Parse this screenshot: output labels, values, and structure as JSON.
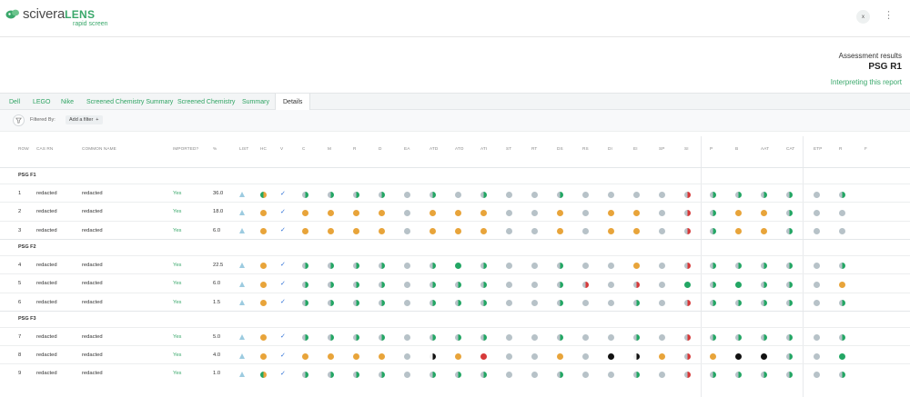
{
  "app": {
    "brand_main": "sciveraLENS",
    "brand_prefix": "scivera",
    "brand_suffix": "LENS",
    "brand_sub": "rapid screen",
    "user_initial": "x",
    "menu_icon": "kebab-icon"
  },
  "report": {
    "label": "Assessment results",
    "title": "PSG R1",
    "help_link": "Interpreting this report"
  },
  "tabs": [
    "Dell",
    "LEGO",
    "Nike",
    "Screened Chemistry Summary",
    "Screened Chemistry",
    "Summary",
    "Details"
  ],
  "active_tab": "Details",
  "filter": {
    "label": "Filtered By:",
    "add_label": "Add a filter",
    "add_icon": "+"
  },
  "table": {
    "columns": [
      "ROW",
      "CAS RN",
      "COMMON NAME",
      "IMPORTED?",
      "%",
      "LIST",
      "HC",
      "V",
      "C",
      "M",
      "R",
      "D",
      "EA",
      "atd",
      "ato",
      "ati",
      "st",
      "rt",
      "ds",
      "rs",
      "di",
      "ei",
      "sp",
      "si",
      "P",
      "B",
      "AAT",
      "CAT",
      "etp",
      "r",
      "f"
    ],
    "groups": [
      {
        "name": "PSG F1",
        "rows": [
          {
            "row": "1",
            "cas": "redacted",
            "name": "redacted",
            "imported": "Yes",
            "pct": "36.0",
            "ind": [
              "tri",
              "og",
              "chk",
              "gg",
              "gg",
              "gg",
              "gg",
              "gl",
              "gg",
              "gl",
              "gg",
              "gl",
              "gl",
              "gg",
              "gl",
              "go",
              "gl",
              "gl",
              "rg",
              "gg",
              "gg",
              "gg",
              "gg",
              "gl",
              "gg"
            ]
          },
          {
            "row": "2",
            "cas": "redacted",
            "name": "redacted",
            "imported": "Yes",
            "pct": "18.0",
            "ind": [
              "tri",
              "o",
              "chk",
              "o",
              "o",
              "o",
              "o",
              "gl",
              "o",
              "o",
              "o",
              "gl",
              "gl",
              "o",
              "gl",
              "o",
              "o",
              "gl",
              "rg",
              "gg",
              "o",
              "o",
              "gg",
              "gl",
              "gl"
            ]
          },
          {
            "row": "3",
            "cas": "redacted",
            "name": "redacted",
            "imported": "Yes",
            "pct": "6.0",
            "ind": [
              "tri",
              "o",
              "chk",
              "o",
              "o",
              "o",
              "o",
              "gl",
              "o",
              "o",
              "o",
              "gl",
              "gl",
              "o",
              "gl",
              "o",
              "o",
              "gl",
              "rg",
              "gg",
              "o",
              "o",
              "gg",
              "gl",
              "gl"
            ]
          }
        ]
      },
      {
        "name": "PSG F2",
        "rows": [
          {
            "row": "4",
            "cas": "redacted",
            "name": "redacted",
            "imported": "Yes",
            "pct": "22.5",
            "ind": [
              "tri",
              "o",
              "chk",
              "gg",
              "gg",
              "gg",
              "gg",
              "gl",
              "gg",
              "G",
              "gg",
              "gl",
              "gl",
              "gg",
              "gl",
              "gl",
              "o",
              "gl",
              "rg",
              "gg",
              "gg",
              "gg",
              "gg",
              "gl",
              "gg"
            ]
          },
          {
            "row": "5",
            "cas": "redacted",
            "name": "redacted",
            "imported": "Yes",
            "pct": "6.0",
            "ind": [
              "tri",
              "o",
              "chk",
              "gg",
              "gg",
              "gg",
              "gg",
              "gl",
              "gg",
              "gg",
              "gg",
              "gl",
              "gl",
              "gg",
              "rg",
              "gl",
              "rg",
              "gl",
              "G",
              "gg",
              "G",
              "gg",
              "gg",
              "gl",
              "o"
            ]
          },
          {
            "row": "6",
            "cas": "redacted",
            "name": "redacted",
            "imported": "Yes",
            "pct": "1.5",
            "ind": [
              "tri",
              "o",
              "chk",
              "gg",
              "gg",
              "gg",
              "gg",
              "gl",
              "gg",
              "gg",
              "gg",
              "gl",
              "gl",
              "gg",
              "gl",
              "gl",
              "gg",
              "gl",
              "rg",
              "gg",
              "gg",
              "gg",
              "gg",
              "gl",
              "gg"
            ]
          }
        ]
      },
      {
        "name": "PSG F3",
        "rows": [
          {
            "row": "7",
            "cas": "redacted",
            "name": "redacted",
            "imported": "Yes",
            "pct": "5.0",
            "ind": [
              "tri",
              "o",
              "chk",
              "gg",
              "gg",
              "gg",
              "gg",
              "gl",
              "gg",
              "gg",
              "gg",
              "gl",
              "gl",
              "gg",
              "gl",
              "gl",
              "gg",
              "gl",
              "rg",
              "gg",
              "gg",
              "gg",
              "gg",
              "gl",
              "gg"
            ]
          },
          {
            "row": "8",
            "cas": "redacted",
            "name": "redacted",
            "imported": "Yes",
            "pct": "4.0",
            "ind": [
              "tri",
              "o",
              "chk",
              "o",
              "o",
              "o",
              "o",
              "gl",
              "kh",
              "o",
              "R",
              "gl",
              "gl",
              "o",
              "gl",
              "K",
              "kh",
              "o",
              "rg",
              "o",
              "K",
              "K",
              "gg",
              "gl",
              "G"
            ]
          },
          {
            "row": "9",
            "cas": "redacted",
            "name": "redacted",
            "imported": "Yes",
            "pct": "1.0",
            "ind": [
              "tri",
              "og",
              "chk",
              "gg",
              "gg",
              "gg",
              "gg",
              "gl",
              "gg",
              "gg",
              "gg",
              "gl",
              "gl",
              "gg",
              "gl",
              "gl",
              "gg",
              "gl",
              "rg",
              "gg",
              "gg",
              "gg",
              "gg",
              "gl",
              "gg"
            ]
          }
        ]
      }
    ]
  },
  "colors": {
    "accent": "#3aa86b",
    "green": "#23a664",
    "orange": "#e8a43a",
    "red": "#d63a3a",
    "grey": "#b7c2c8",
    "black": "#111111",
    "blue_check": "#2c6fd6",
    "triangle": "#9ccbe0"
  }
}
